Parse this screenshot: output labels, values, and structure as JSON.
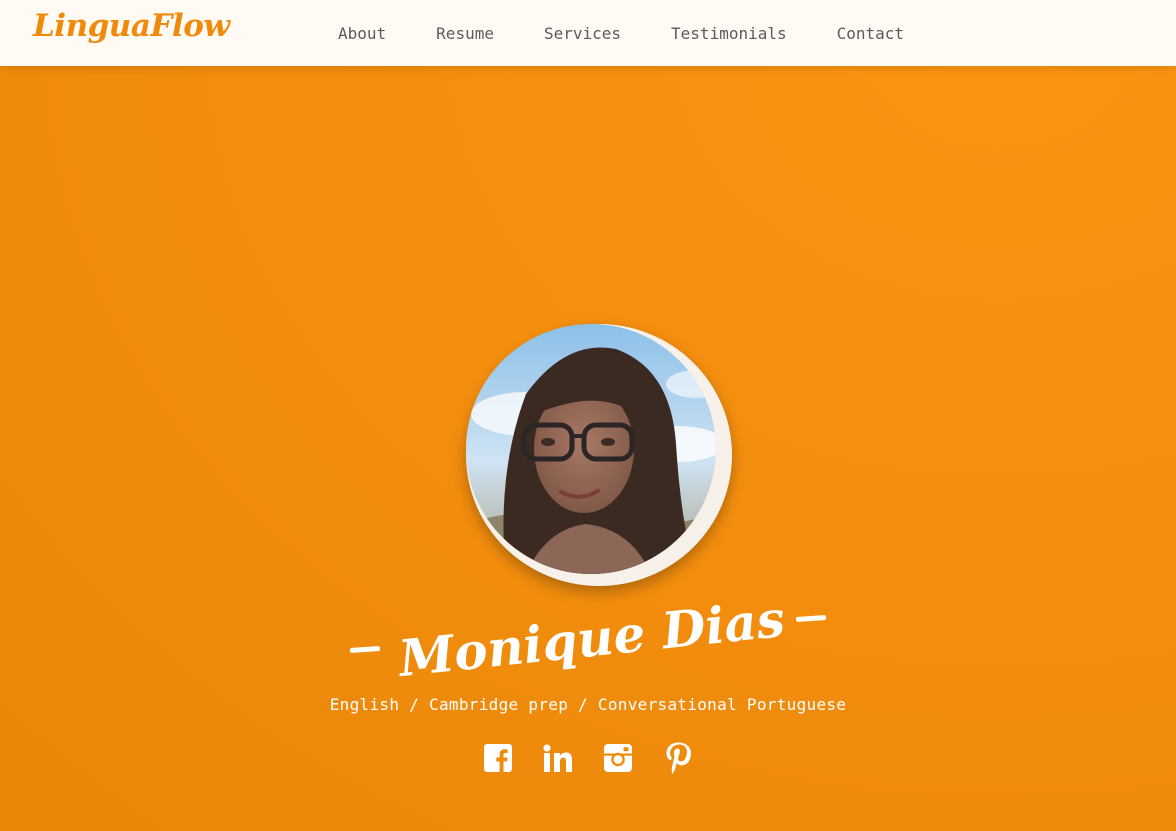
{
  "header": {
    "logo": "LinguaFlow",
    "nav": [
      {
        "label": "About"
      },
      {
        "label": "Resume"
      },
      {
        "label": "Services"
      },
      {
        "label": "Testimonials"
      },
      {
        "label": "Contact"
      }
    ]
  },
  "hero": {
    "name": "Monique Dias",
    "subtitle": "English / Cambridge prep / Conversational Portuguese",
    "socials": [
      {
        "icon": "facebook-icon"
      },
      {
        "icon": "linkedin-icon"
      },
      {
        "icon": "instagram-icon"
      },
      {
        "icon": "pinterest-icon"
      }
    ]
  },
  "colors": {
    "accent": "#f08a0a",
    "hero_background": "#f08c0d",
    "header_background": "#fffaf4",
    "nav_text": "#5b5b5b",
    "hero_text": "#ffffff"
  }
}
